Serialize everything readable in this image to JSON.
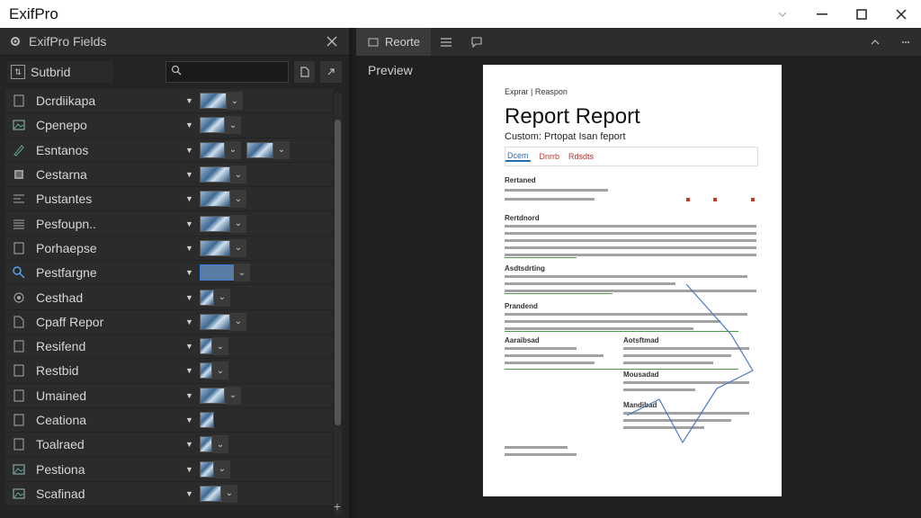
{
  "window": {
    "title": "ExifPro"
  },
  "left_panel": {
    "title": "ExifPro Fields",
    "sort_label": "Sutbrid",
    "search_placeholder": "",
    "fields": [
      {
        "label": "Dcrdiikapa",
        "icon": "square-icon"
      },
      {
        "label": "Cpenepo",
        "icon": "image-icon"
      },
      {
        "label": "Esntanos",
        "icon": "pencil-icon"
      },
      {
        "label": "Cestarna",
        "icon": "list-icon"
      },
      {
        "label": "Pustantes",
        "icon": "align-icon"
      },
      {
        "label": "Pesfoupn..",
        "icon": "lines-icon"
      },
      {
        "label": "Porhaepse",
        "icon": "square-icon"
      },
      {
        "label": "Pestfargne",
        "icon": "search-icon"
      },
      {
        "label": "Cesthad",
        "icon": "layers-icon"
      },
      {
        "label": "Cpaff Repor",
        "icon": "document-icon"
      },
      {
        "label": "Resifend",
        "icon": "square-icon"
      },
      {
        "label": "Restbid",
        "icon": "square-icon"
      },
      {
        "label": "Umained",
        "icon": "square-icon"
      },
      {
        "label": "Ceationa",
        "icon": "square-icon"
      },
      {
        "label": "Toalraed",
        "icon": "square-icon"
      },
      {
        "label": "Pestiona",
        "icon": "image-icon"
      },
      {
        "label": "Scafinad",
        "icon": "image-icon"
      }
    ]
  },
  "right_panel": {
    "tab_label": "Reorte",
    "preview_label": "Preview"
  },
  "document": {
    "header": "Exprar | Reaspon",
    "title": "Report Report",
    "subtitle": "Custom: Prtopat Isan feport",
    "tabs": [
      "Dcem",
      "Dnrrb",
      "Rdsdts"
    ],
    "sections": [
      "Rertaned",
      "Rertdnord",
      "Asdtsdrting",
      "Prandend",
      "Aaraibsad",
      "Aotsftmad",
      "Mousadad",
      "Mandibad"
    ]
  },
  "colors": {
    "accent": "#3b7bd8",
    "doc_link": "#2a6bb5",
    "doc_red": "#c0392b"
  }
}
